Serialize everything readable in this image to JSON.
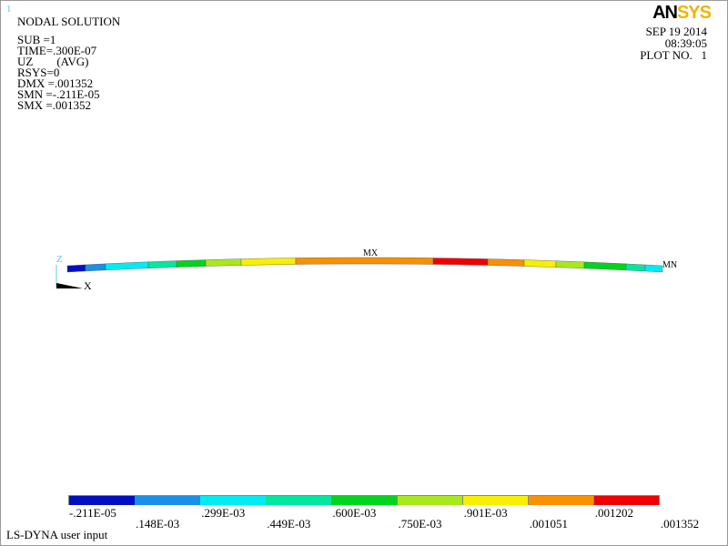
{
  "window_number": "1",
  "info": {
    "title": "NODAL SOLUTION",
    "lines": [
      "SUB =1",
      "TIME=.300E-07",
      "UZ        (AVG)",
      "RSYS=0",
      "DMX =.001352",
      "SMN =-.211E-05",
      "SMX =.001352"
    ]
  },
  "header_right": {
    "logo": "ANSYS",
    "date": "SEP 19 2014",
    "time": "08:39:05",
    "plot_no": "PLOT NO.   1"
  },
  "model": {
    "max_label": "MX",
    "min_label": "MN",
    "axis_z": "Z",
    "axis_x": "X",
    "band_sequence": [
      0,
      1,
      2,
      3,
      4,
      5,
      6,
      7,
      8,
      7,
      6,
      5,
      4,
      3,
      2,
      1,
      0
    ]
  },
  "legend": {
    "colors": [
      "#0010c0",
      "#1890e8",
      "#00ecf4",
      "#00e8a0",
      "#00d41c",
      "#a8e81c",
      "#f8f000",
      "#f89000",
      "#f00000"
    ],
    "labels": [
      "-.211E-05",
      ".148E-03",
      ".299E-03",
      ".449E-03",
      ".600E-03",
      ".750E-03",
      ".901E-03",
      ".001051",
      ".001202",
      ".001352"
    ]
  },
  "footer": "LS-DYNA user input"
}
